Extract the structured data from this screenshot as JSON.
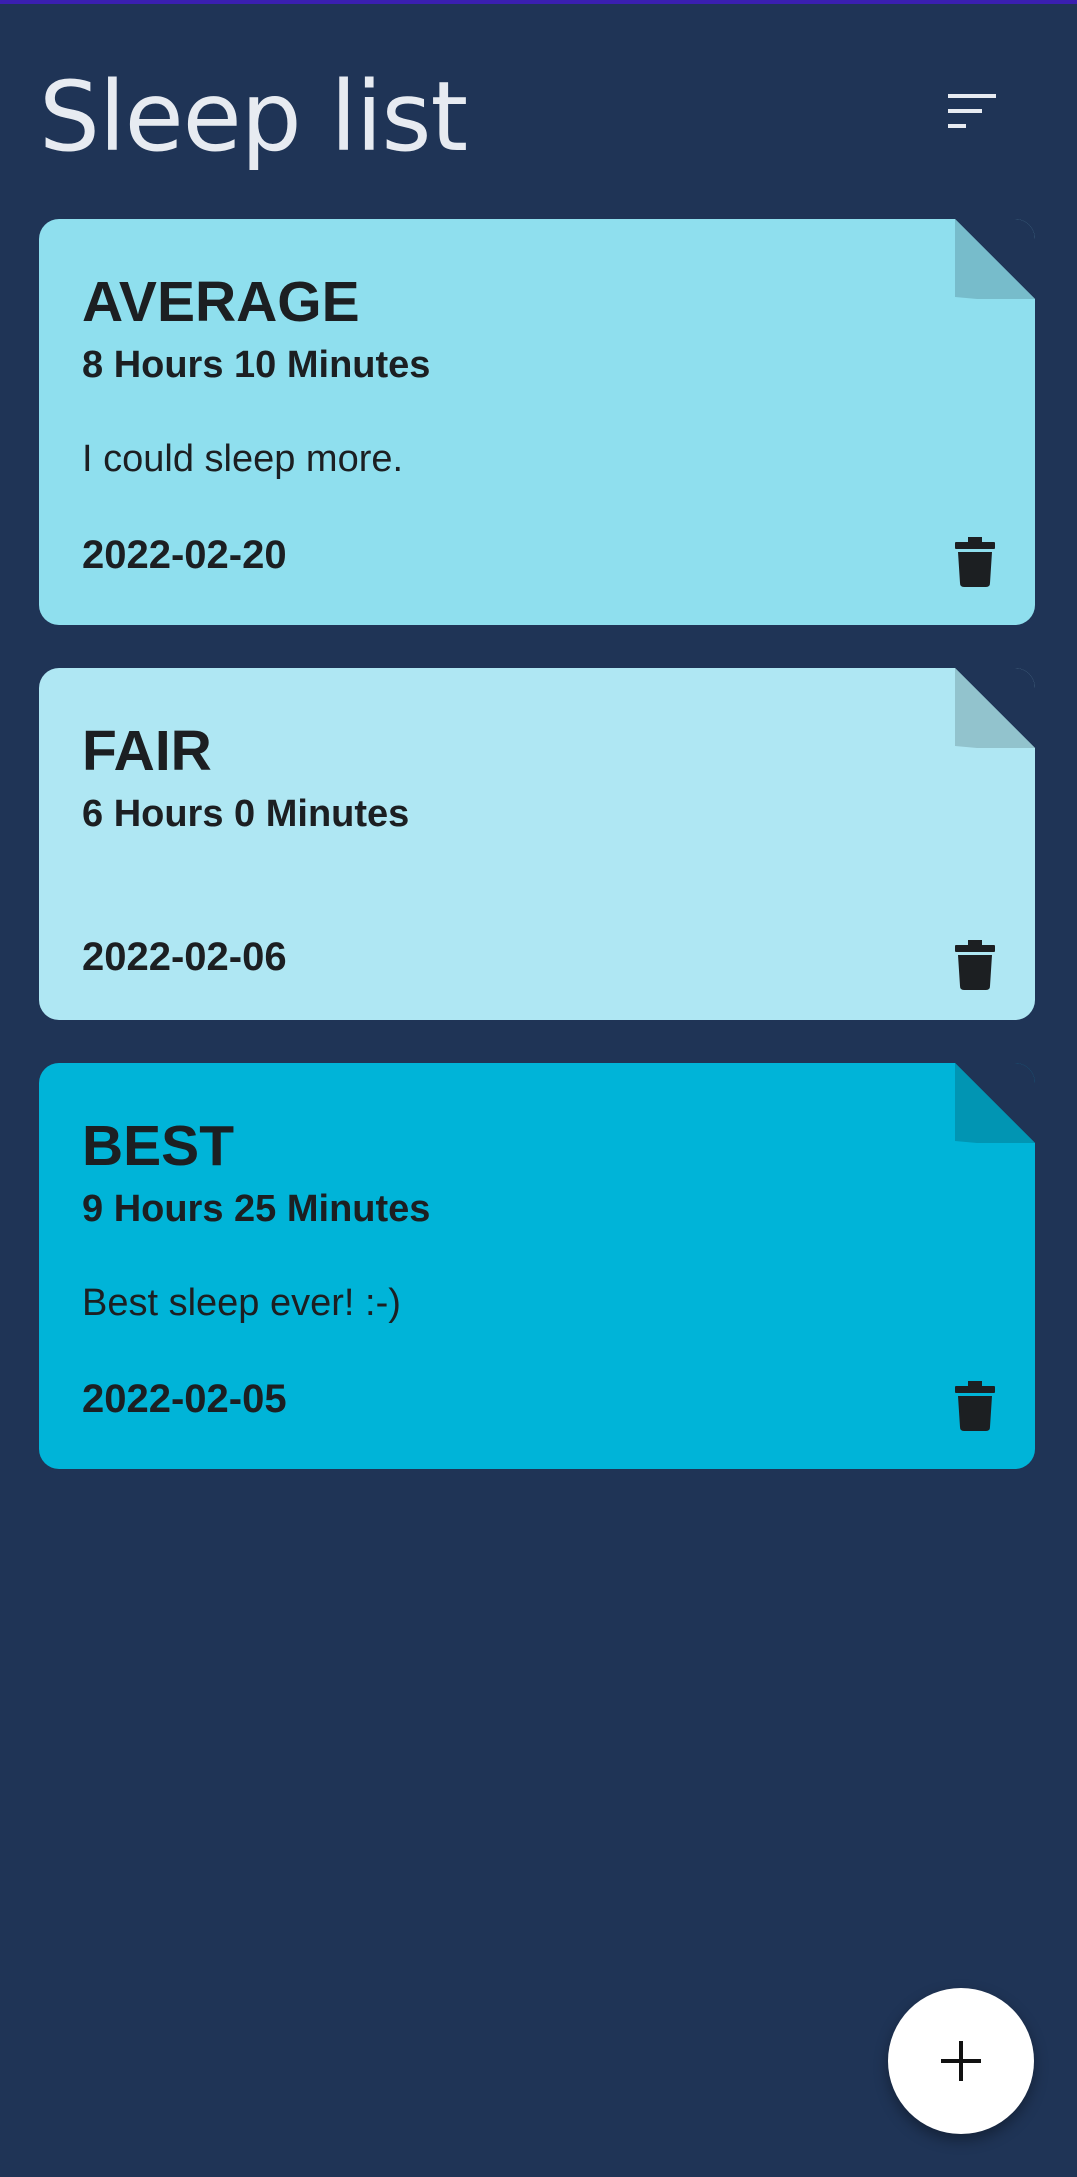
{
  "screen": {
    "title": "Sleep list",
    "sort_icon": "sort-icon"
  },
  "entries": [
    {
      "rating": "AVERAGE",
      "duration": "8 Hours 10 Minutes",
      "note": "I could sleep more.",
      "date": "2022-02-20",
      "color": "#8fdfee"
    },
    {
      "rating": "FAIR",
      "duration": "6 Hours 0 Minutes",
      "note": "",
      "date": "2022-02-06",
      "color": "#afe7f3"
    },
    {
      "rating": "BEST",
      "duration": "9 Hours 25 Minutes",
      "note": "Best sleep ever! :-)",
      "date": "2022-02-05",
      "color": "#00b4d8"
    }
  ],
  "icons": {
    "delete": "trash-icon",
    "add": "plus-icon"
  },
  "colors": {
    "background": "#1f3456",
    "title_text": "#e7ebf1",
    "card_text": "#1c1f22",
    "fab": "#ffffff"
  }
}
